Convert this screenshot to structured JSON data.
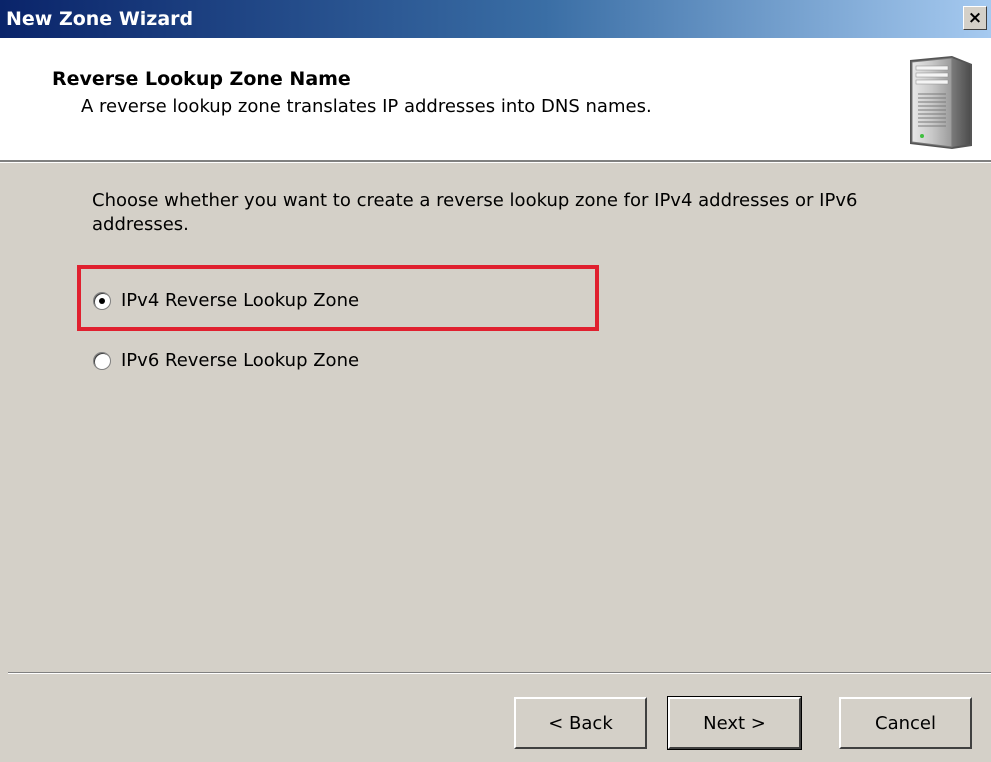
{
  "window": {
    "title": "New Zone Wizard",
    "close_glyph": "×"
  },
  "header": {
    "title": "Reverse Lookup Zone Name",
    "subtitle": "A reverse lookup zone translates IP addresses into DNS names.",
    "icon": "server-icon"
  },
  "content": {
    "instruction": "Choose whether you want to create a reverse lookup zone for IPv4 addresses or IPv6 addresses.",
    "options": [
      {
        "label": "IPv4 Reverse Lookup Zone",
        "selected": true
      },
      {
        "label": "IPv6 Reverse Lookup Zone",
        "selected": false
      }
    ],
    "highlight_color": "#e0202f"
  },
  "footer": {
    "back_label": "< Back",
    "next_label": "Next >",
    "cancel_label": "Cancel"
  }
}
